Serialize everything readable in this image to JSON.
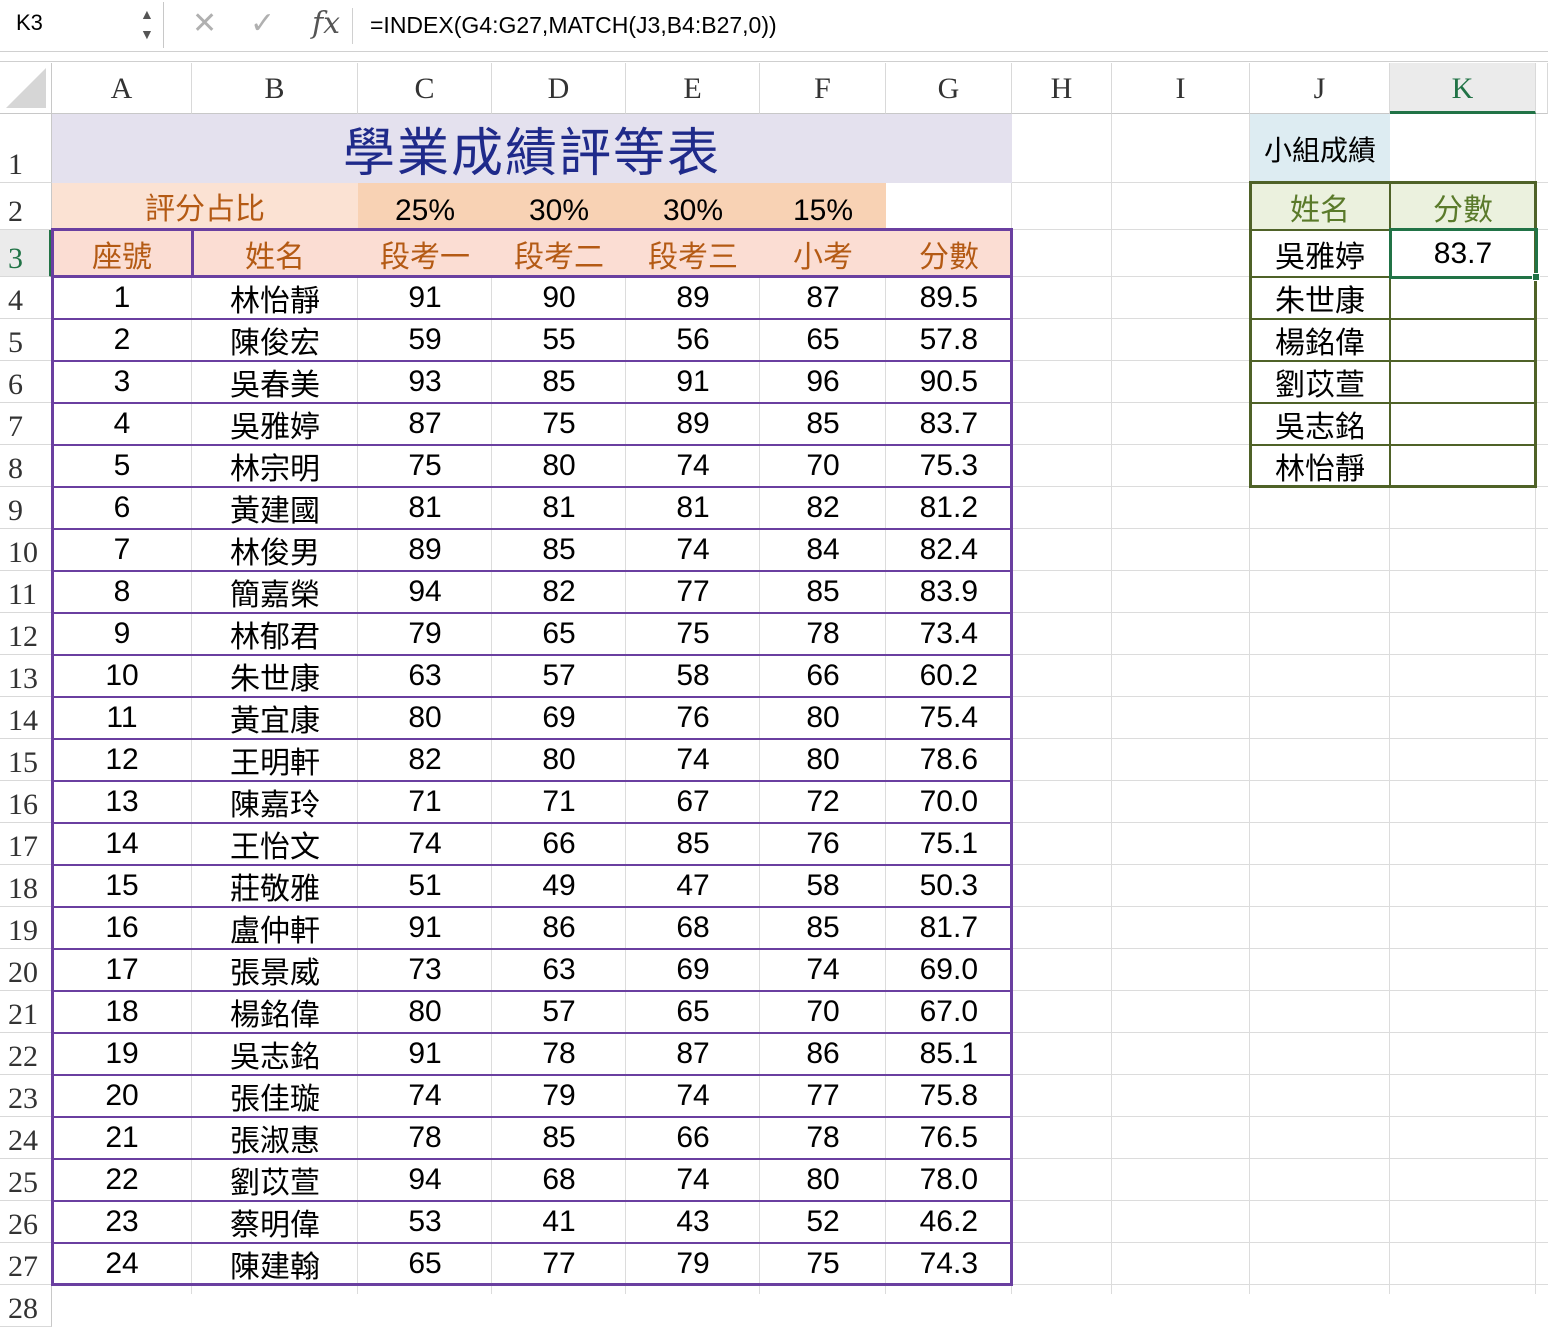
{
  "formula_bar": {
    "name_box": "K3",
    "fx": "fx",
    "formula": "=INDEX(G4:G27,MATCH(J3,B4:B27,0))"
  },
  "columns": [
    "A",
    "B",
    "C",
    "D",
    "E",
    "F",
    "G",
    "H",
    "I",
    "J",
    "K"
  ],
  "selected_column": "K",
  "row_numbers": [
    "1",
    "2",
    "3",
    "4",
    "5",
    "6",
    "7",
    "8",
    "9",
    "10",
    "11",
    "12",
    "13",
    "14",
    "15",
    "16",
    "17",
    "18",
    "19",
    "20",
    "21",
    "22",
    "23",
    "24",
    "25",
    "26",
    "27",
    "28"
  ],
  "selected_row": "3",
  "sheet": {
    "title": "學業成績評等表",
    "weight_label": "評分占比",
    "weights": [
      "25%",
      "30%",
      "30%",
      "15%"
    ],
    "headers": [
      "座號",
      "姓名",
      "段考一",
      "段考二",
      "段考三",
      "小考",
      "分數"
    ],
    "rows": [
      [
        "1",
        "林怡靜",
        "91",
        "90",
        "89",
        "87",
        "89.5"
      ],
      [
        "2",
        "陳俊宏",
        "59",
        "55",
        "56",
        "65",
        "57.8"
      ],
      [
        "3",
        "吳春美",
        "93",
        "85",
        "91",
        "96",
        "90.5"
      ],
      [
        "4",
        "吳雅婷",
        "87",
        "75",
        "89",
        "85",
        "83.7"
      ],
      [
        "5",
        "林宗明",
        "75",
        "80",
        "74",
        "70",
        "75.3"
      ],
      [
        "6",
        "黃建國",
        "81",
        "81",
        "81",
        "82",
        "81.2"
      ],
      [
        "7",
        "林俊男",
        "89",
        "85",
        "74",
        "84",
        "82.4"
      ],
      [
        "8",
        "簡嘉榮",
        "94",
        "82",
        "77",
        "85",
        "83.9"
      ],
      [
        "9",
        "林郁君",
        "79",
        "65",
        "75",
        "78",
        "73.4"
      ],
      [
        "10",
        "朱世康",
        "63",
        "57",
        "58",
        "66",
        "60.2"
      ],
      [
        "11",
        "黃宜康",
        "80",
        "69",
        "76",
        "80",
        "75.4"
      ],
      [
        "12",
        "王明軒",
        "82",
        "80",
        "74",
        "80",
        "78.6"
      ],
      [
        "13",
        "陳嘉玲",
        "71",
        "71",
        "67",
        "72",
        "70.0"
      ],
      [
        "14",
        "王怡文",
        "74",
        "66",
        "85",
        "76",
        "75.1"
      ],
      [
        "15",
        "莊敬雅",
        "51",
        "49",
        "47",
        "58",
        "50.3"
      ],
      [
        "16",
        "盧仲軒",
        "91",
        "86",
        "68",
        "85",
        "81.7"
      ],
      [
        "17",
        "張景威",
        "73",
        "63",
        "69",
        "74",
        "69.0"
      ],
      [
        "18",
        "楊銘偉",
        "80",
        "57",
        "65",
        "70",
        "67.0"
      ],
      [
        "19",
        "吳志銘",
        "91",
        "78",
        "87",
        "86",
        "85.1"
      ],
      [
        "20",
        "張佳璇",
        "74",
        "79",
        "74",
        "77",
        "75.8"
      ],
      [
        "21",
        "張淑惠",
        "78",
        "85",
        "66",
        "78",
        "76.5"
      ],
      [
        "22",
        "劉苡萱",
        "94",
        "68",
        "74",
        "80",
        "78.0"
      ],
      [
        "23",
        "蔡明偉",
        "53",
        "41",
        "43",
        "52",
        "46.2"
      ],
      [
        "24",
        "陳建翰",
        "65",
        "77",
        "79",
        "75",
        "74.3"
      ]
    ]
  },
  "group": {
    "title": "小組成績",
    "headers": [
      "姓名",
      "分數"
    ],
    "rows": [
      [
        "吳雅婷",
        "83.7"
      ],
      [
        "朱世康",
        ""
      ],
      [
        "楊銘偉",
        ""
      ],
      [
        "劉苡萱",
        ""
      ],
      [
        "吳志銘",
        ""
      ],
      [
        "林怡靜",
        ""
      ]
    ]
  },
  "colors": {
    "title_text": "#1f2a8a",
    "title_fill": "#e4e1ee",
    "weight_fill": "#fbe2d3",
    "weight_value_fill": "#f8d2b4",
    "header_fill": "#fbddd3",
    "header_text": "#b45a14",
    "table_border": "#6a3fa0",
    "group_title_fill": "#ddecf2",
    "group_header_fill": "#ebf1de",
    "group_header_text": "#5a7a2a",
    "group_border": "#4f6228",
    "selection": "#217346"
  }
}
